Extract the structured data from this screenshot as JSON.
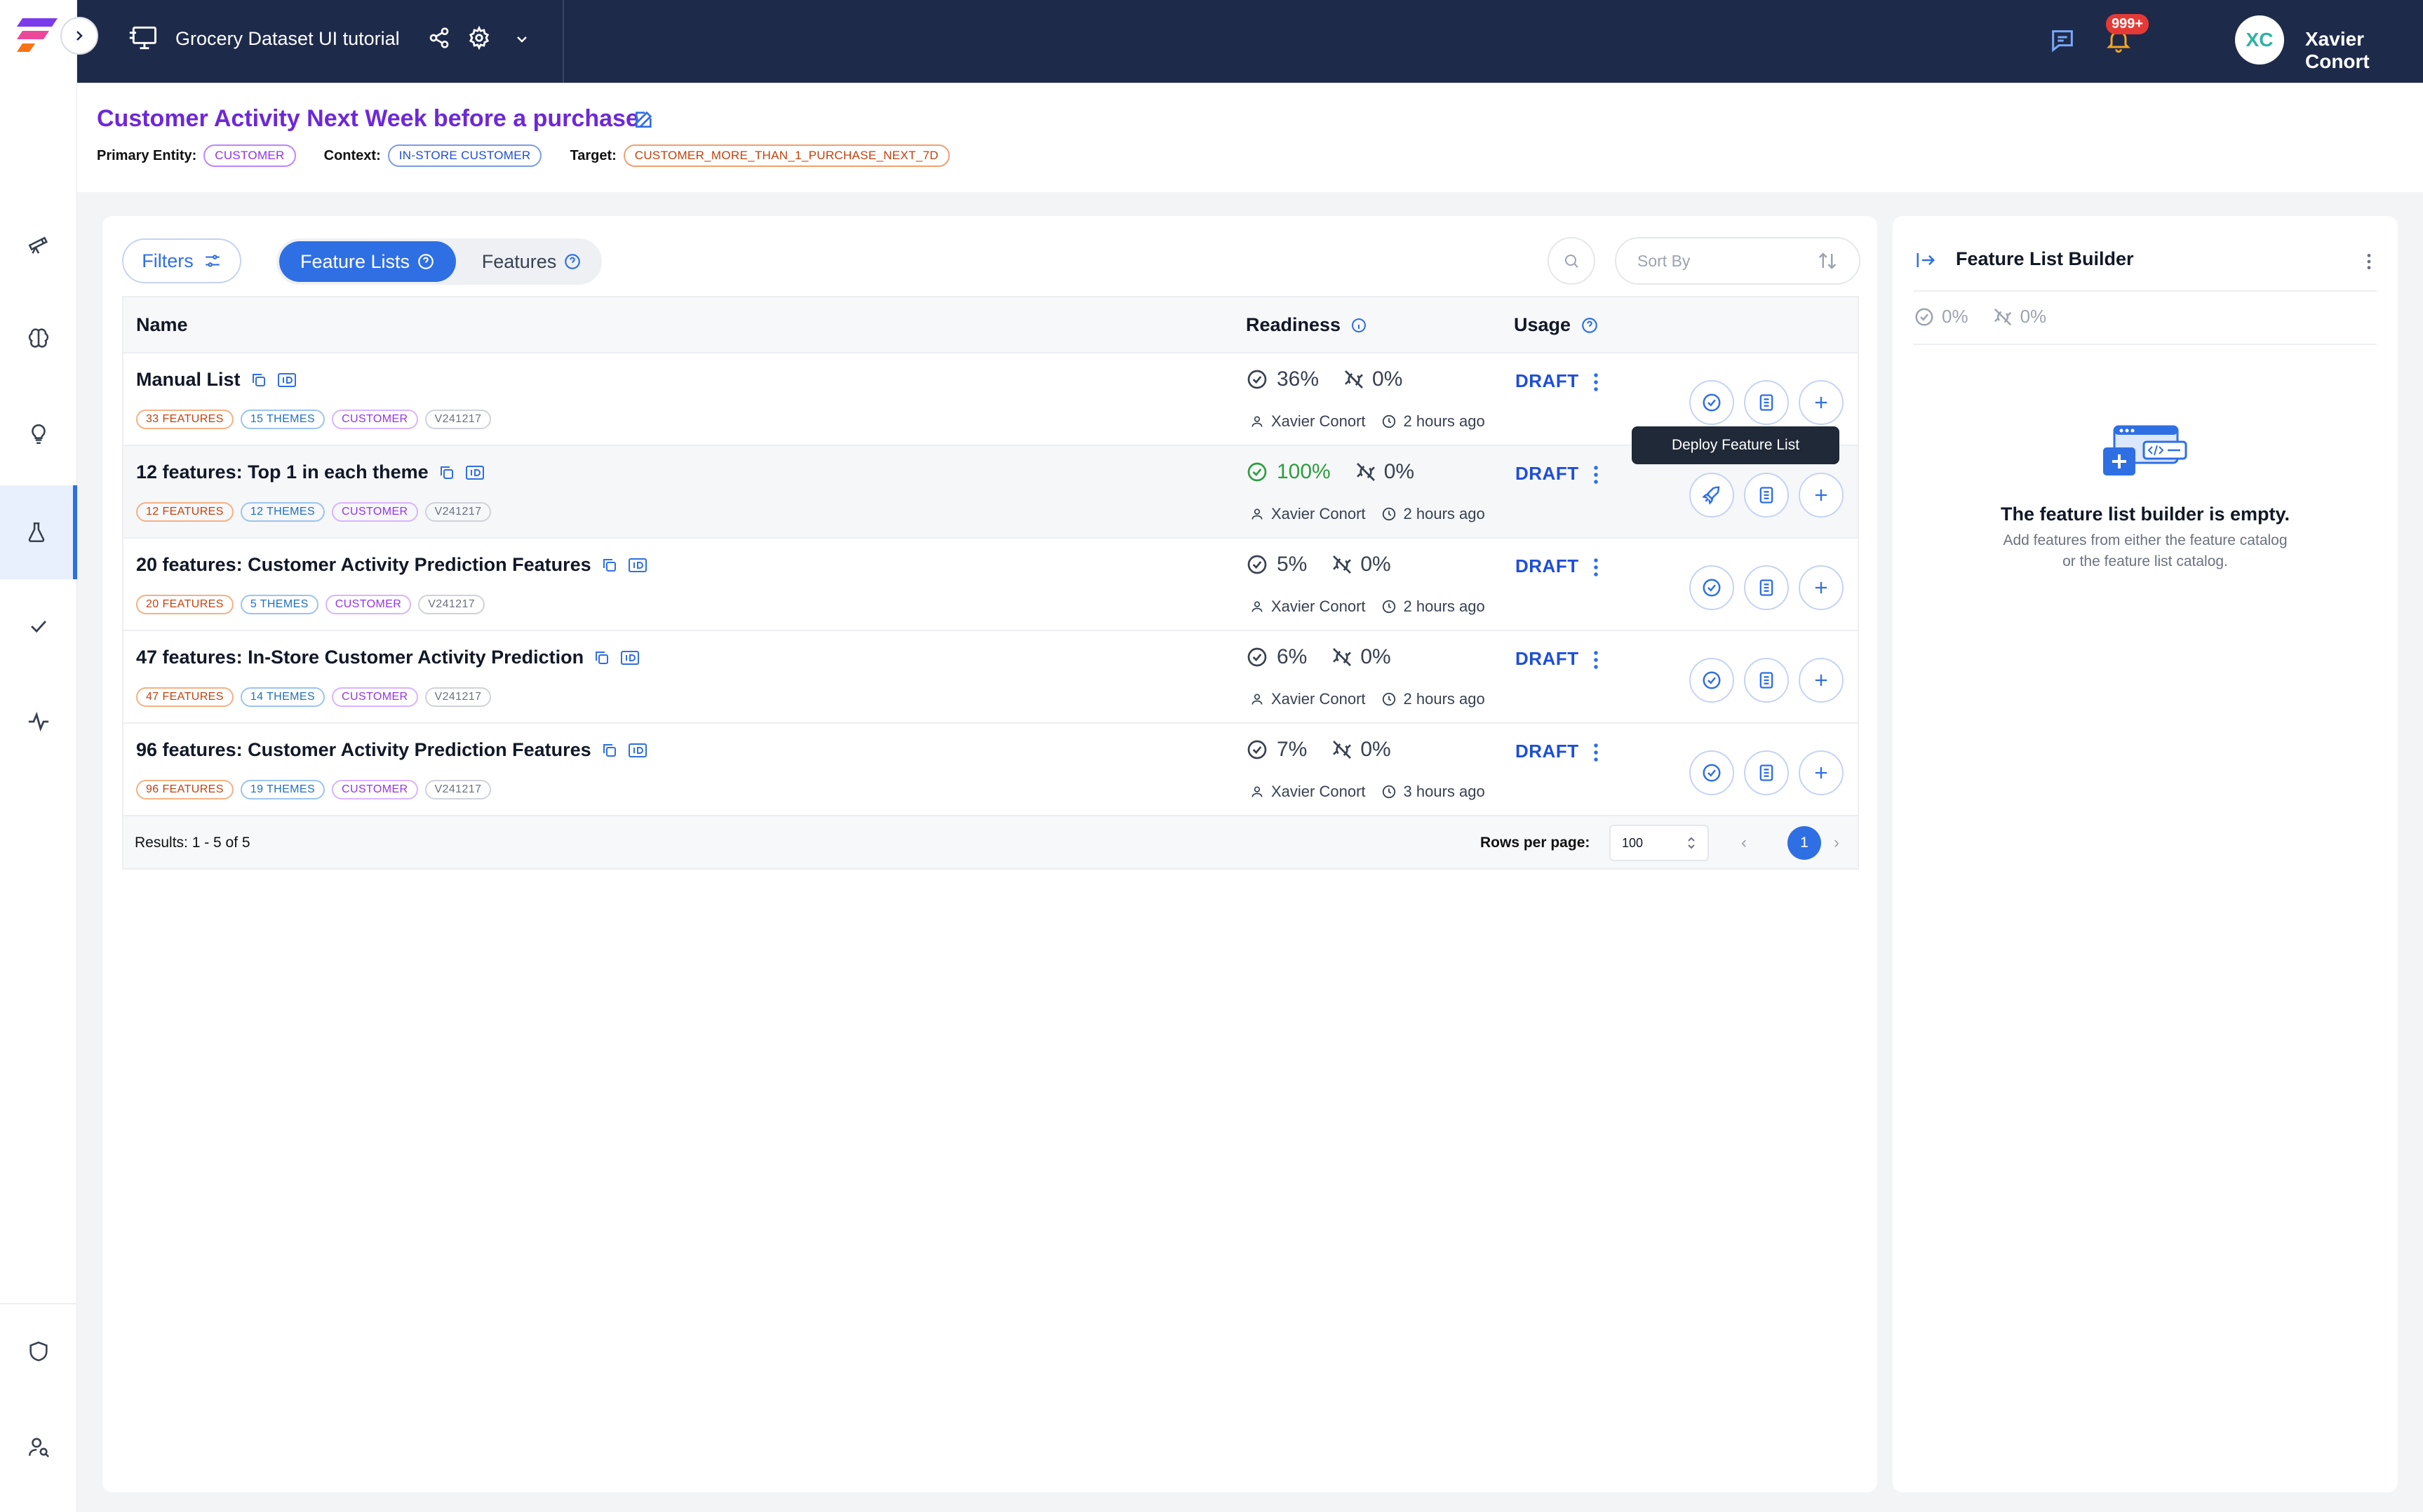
{
  "topbar": {
    "dataset_title": "Grocery Dataset UI tutorial",
    "notification_count": "999+",
    "user_initials": "XC",
    "user_name": "Xavier Conort"
  },
  "header": {
    "title": "Customer Activity Next Week before a purchase",
    "primary_entity_label": "Primary Entity:",
    "primary_entity": "CUSTOMER",
    "context_label": "Context:",
    "context": "IN-STORE CUSTOMER",
    "target_label": "Target:",
    "target": "CUSTOMER_MORE_THAN_1_PURCHASE_NEXT_7D"
  },
  "toolbar": {
    "filters_label": "Filters",
    "tab_feature_lists": "Feature Lists",
    "tab_features": "Features",
    "sort_placeholder": "Sort By"
  },
  "table": {
    "columns": {
      "name": "Name",
      "readiness": "Readiness",
      "usage": "Usage"
    },
    "rows": [
      {
        "name": "Manual List",
        "tags": [
          "33 FEATURES",
          "15 THEMES",
          "CUSTOMER",
          "V241217"
        ],
        "readiness": "36%",
        "online": "0%",
        "owner": "Xavier Conort",
        "time": "2 hours ago",
        "usage": "DRAFT"
      },
      {
        "name": "12 features: Top 1 in each theme",
        "tags": [
          "12 FEATURES",
          "12 THEMES",
          "CUSTOMER",
          "V241217"
        ],
        "readiness": "100%",
        "online": "0%",
        "owner": "Xavier Conort",
        "time": "2 hours ago",
        "usage": "DRAFT"
      },
      {
        "name": "20 features: Customer Activity Prediction Features",
        "tags": [
          "20 FEATURES",
          "5 THEMES",
          "CUSTOMER",
          "V241217"
        ],
        "readiness": "5%",
        "online": "0%",
        "owner": "Xavier Conort",
        "time": "2 hours ago",
        "usage": "DRAFT"
      },
      {
        "name": "47 features: In-Store Customer Activity Prediction",
        "tags": [
          "47 FEATURES",
          "14 THEMES",
          "CUSTOMER",
          "V241217"
        ],
        "readiness": "6%",
        "online": "0%",
        "owner": "Xavier Conort",
        "time": "2 hours ago",
        "usage": "DRAFT"
      },
      {
        "name": "96 features: Customer Activity Prediction Features",
        "tags": [
          "96 FEATURES",
          "19 THEMES",
          "CUSTOMER",
          "V241217"
        ],
        "readiness": "7%",
        "online": "0%",
        "owner": "Xavier Conort",
        "time": "3 hours ago",
        "usage": "DRAFT"
      }
    ],
    "tooltip": "Deploy Feature List",
    "footer": {
      "results": "Results: 1 - 5 of 5",
      "rows_per_page_label": "Rows per page:",
      "rows_per_page": "100",
      "current_page": "1"
    }
  },
  "builder": {
    "title": "Feature List Builder",
    "readiness": "0%",
    "online": "0%",
    "empty_title": "The feature list builder is empty.",
    "empty_line1": "Add features from either the feature catalog",
    "empty_line2": "or the feature list catalog."
  },
  "colors": {
    "topbar_bg": "#1e2a4a",
    "accent_blue": "#2f6fe4",
    "title_purple": "#6d28d9",
    "ready_green": "#2e9d3f"
  }
}
